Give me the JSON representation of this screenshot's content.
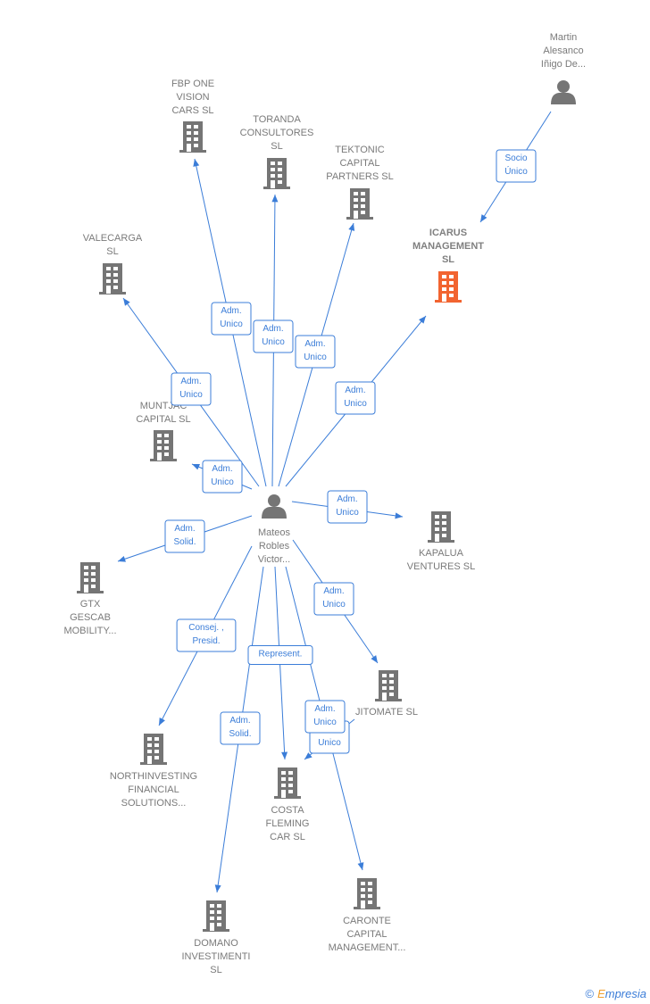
{
  "colors": {
    "edge": "#3b7dd8",
    "node": "#757575",
    "highlight": "#f26430"
  },
  "nodes": [
    {
      "id": "center",
      "type": "person",
      "icon": "person-icon",
      "label": [
        "Mateos",
        "Robles",
        "Victor..."
      ]
    },
    {
      "id": "martin",
      "type": "person",
      "icon": "person-icon",
      "label": [
        "Martin",
        "Alesanco",
        "Iñigo De..."
      ]
    },
    {
      "id": "icarus",
      "type": "company",
      "icon": "building-icon",
      "highlight": true,
      "label": [
        "ICARUS",
        "MANAGEMENT",
        "SL"
      ]
    },
    {
      "id": "fbp",
      "type": "company",
      "icon": "building-icon",
      "label": [
        "FBP ONE",
        "VISION",
        "CARS  SL"
      ]
    },
    {
      "id": "toranda",
      "type": "company",
      "icon": "building-icon",
      "label": [
        "TORANDA",
        "CONSULTORES",
        "SL"
      ]
    },
    {
      "id": "tektonic",
      "type": "company",
      "icon": "building-icon",
      "label": [
        "TEKTONIC",
        "CAPITAL",
        "PARTNERS  SL"
      ]
    },
    {
      "id": "valecarga",
      "type": "company",
      "icon": "building-icon",
      "label": [
        "VALECARGA",
        "SL"
      ]
    },
    {
      "id": "muntjac",
      "type": "company",
      "icon": "building-icon",
      "label": [
        "MUNTJAC",
        "CAPITAL  SL"
      ]
    },
    {
      "id": "kapalua",
      "type": "company",
      "icon": "building-icon",
      "label": [
        "KAPALUA",
        "VENTURES  SL"
      ]
    },
    {
      "id": "gtx",
      "type": "company",
      "icon": "building-icon",
      "label": [
        "GTX",
        "GESCAB",
        "MOBILITY..."
      ]
    },
    {
      "id": "jitomate",
      "type": "company",
      "icon": "building-icon",
      "label": [
        "JITOMATE SL"
      ]
    },
    {
      "id": "northinvesting",
      "type": "company",
      "icon": "building-icon",
      "label": [
        "NORTHINVESTING",
        "FINANCIAL",
        "SOLUTIONS..."
      ]
    },
    {
      "id": "costa",
      "type": "company",
      "icon": "building-icon",
      "label": [
        "COSTA",
        "FLEMING",
        "CAR  SL"
      ]
    },
    {
      "id": "caronte",
      "type": "company",
      "icon": "building-icon",
      "label": [
        "CARONTE",
        "CAPITAL",
        "MANAGEMENT..."
      ]
    },
    {
      "id": "domano",
      "type": "company",
      "icon": "building-icon",
      "label": [
        "DOMANO",
        "INVESTIMENTI",
        "SL"
      ]
    }
  ],
  "edges": [
    {
      "from": "martin",
      "to": "icarus",
      "label": [
        "Socio",
        "Único"
      ]
    },
    {
      "from": "center",
      "to": "fbp",
      "label": [
        "Adm.",
        "Unico"
      ]
    },
    {
      "from": "center",
      "to": "toranda",
      "label": [
        "Adm.",
        "Unico"
      ]
    },
    {
      "from": "center",
      "to": "tektonic",
      "label": [
        "Adm.",
        "Unico"
      ]
    },
    {
      "from": "center",
      "to": "valecarga",
      "label": [
        "Adm.",
        "Unico"
      ]
    },
    {
      "from": "center",
      "to": "icarus",
      "label": [
        "Adm.",
        "Unico"
      ]
    },
    {
      "from": "center",
      "to": "muntjac",
      "label": [
        "Adm.",
        "Unico"
      ]
    },
    {
      "from": "center",
      "to": "kapalua",
      "label": [
        "Adm.",
        "Unico"
      ]
    },
    {
      "from": "center",
      "to": "gtx",
      "label": [
        "Adm.",
        "Solid."
      ]
    },
    {
      "from": "center",
      "to": "jitomate",
      "label": [
        "Adm.",
        "Unico"
      ]
    },
    {
      "from": "center",
      "to": "northinvesting",
      "label": [
        "Consej. ,",
        "Presid."
      ]
    },
    {
      "from": "center",
      "to": "costa",
      "label": [
        "Represent."
      ]
    },
    {
      "from": "jitomate",
      "to": "costa",
      "label": [
        "Adm.",
        "Unico"
      ]
    },
    {
      "from": "center",
      "to": "domano",
      "label": [
        "Adm.",
        "Solid."
      ]
    },
    {
      "from": "center",
      "to": "caronte",
      "label": [
        "Adm.",
        "Unico"
      ]
    }
  ],
  "footer": {
    "copyright": "©",
    "brand": "Empresia"
  }
}
